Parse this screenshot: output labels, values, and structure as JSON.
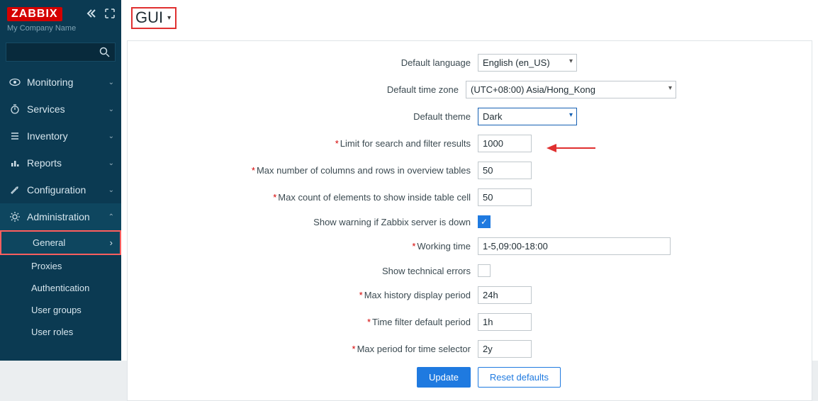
{
  "brand": {
    "logo": "ZABBIX",
    "company": "My Company Name"
  },
  "search": {
    "placeholder": ""
  },
  "nav": {
    "items": [
      {
        "label": "Monitoring"
      },
      {
        "label": "Services"
      },
      {
        "label": "Inventory"
      },
      {
        "label": "Reports"
      },
      {
        "label": "Configuration"
      },
      {
        "label": "Administration"
      }
    ],
    "sub": [
      {
        "label": "General"
      },
      {
        "label": "Proxies"
      },
      {
        "label": "Authentication"
      },
      {
        "label": "User groups"
      },
      {
        "label": "User roles"
      }
    ]
  },
  "header": {
    "title": "GUI"
  },
  "form": {
    "labels": {
      "default_language": "Default language",
      "default_timezone": "Default time zone",
      "default_theme": "Default theme",
      "search_limit": "Limit for search and filter results",
      "max_overview": "Max number of columns and rows in overview tables",
      "max_table_cell": "Max count of elements to show inside table cell",
      "server_warning": "Show warning if Zabbix server is down",
      "working_time": "Working time",
      "show_technical": "Show technical errors",
      "history_period": "Max history display period",
      "filter_default": "Time filter default period",
      "max_period": "Max period for time selector"
    },
    "values": {
      "default_language": "English (en_US)",
      "default_timezone": "(UTC+08:00) Asia/Hong_Kong",
      "default_theme": "Dark",
      "search_limit": "1000",
      "max_overview": "50",
      "max_table_cell": "50",
      "server_warning": true,
      "working_time": "1-5,09:00-18:00",
      "show_technical": false,
      "history_period": "24h",
      "filter_default": "1h",
      "max_period": "2y"
    },
    "buttons": {
      "update": "Update",
      "reset": "Reset defaults"
    }
  }
}
